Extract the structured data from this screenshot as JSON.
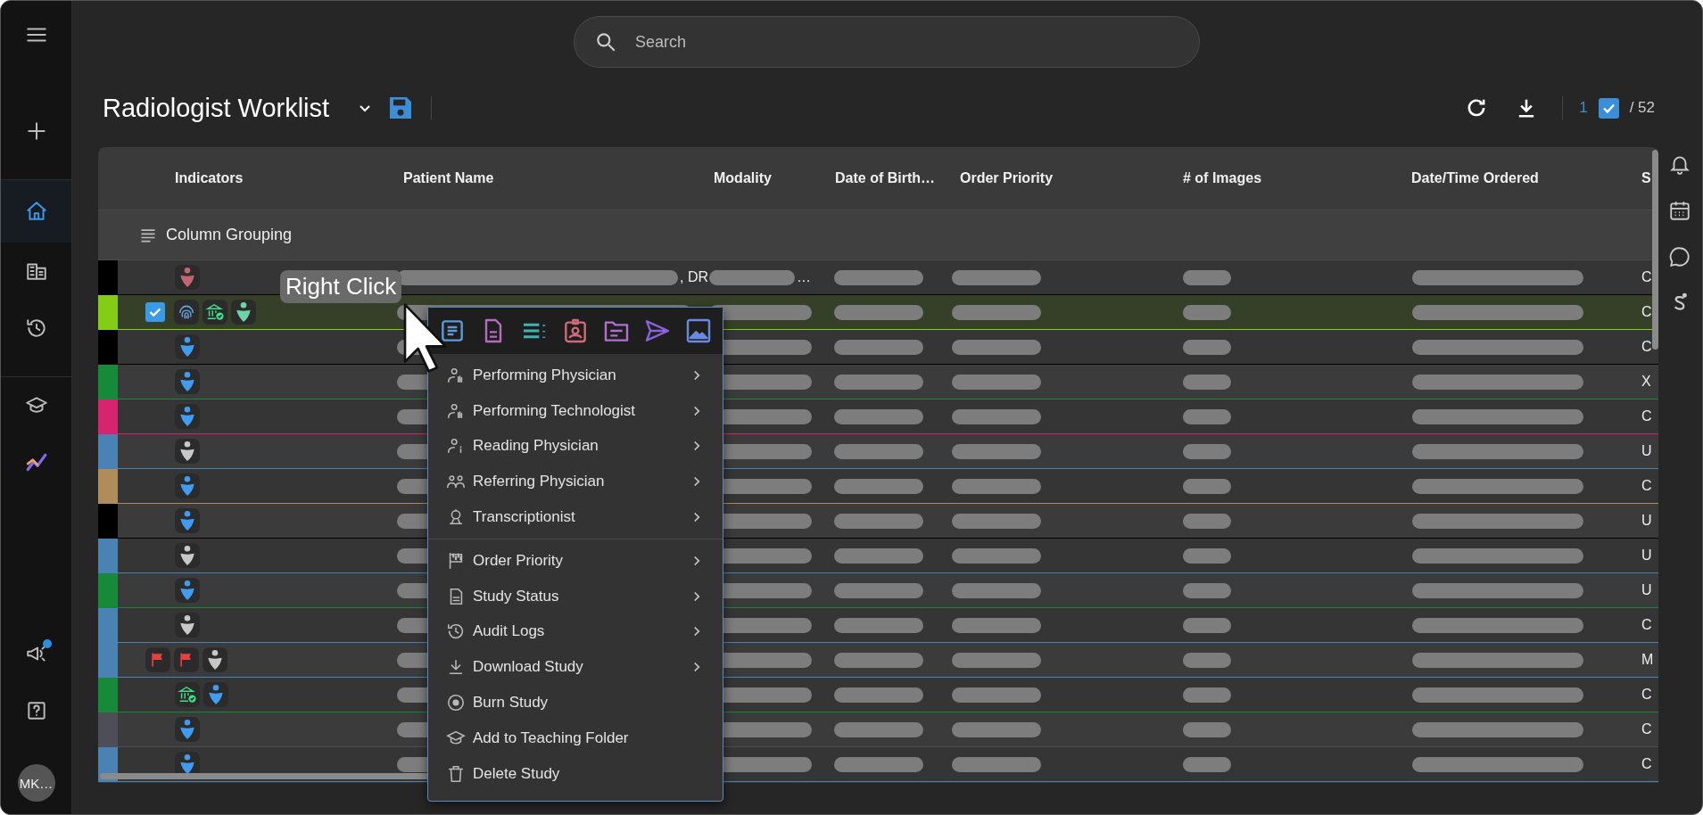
{
  "sidebar": {
    "items": [
      {
        "selected": false
      },
      {
        "selected": false
      },
      {
        "selected": true
      },
      {
        "selected": false
      },
      {
        "selected": false
      },
      {
        "selected": false
      },
      {
        "selected": false
      },
      {
        "selected": false,
        "notification": true
      },
      {
        "selected": false
      }
    ],
    "avatar": {
      "initials": "MK…"
    }
  },
  "search": {
    "placeholder": "Search"
  },
  "title": "Radiologist Worklist",
  "selection": {
    "count": "1",
    "checked": true,
    "total": "/ 52"
  },
  "table": {
    "columns": [
      "Indicators",
      "Patient Name",
      "Modality",
      "Date of Birth…",
      "Order Priority",
      "# of Images",
      "Date/Time Ordered",
      "S"
    ],
    "grouping": "Column Grouping",
    "rows": [
      {
        "color": "#000000",
        "selected": false,
        "indicators": [
          {
            "kind": "person",
            "color": "#c4646f"
          }
        ],
        "patient_name": ", DR",
        "modality": "…",
        "column_8": "C"
      },
      {
        "color": "#84cc16",
        "selected": true,
        "indicators": [
          {
            "kind": "fingerprint"
          },
          {
            "kind": "facility_check"
          },
          {
            "kind": "person",
            "color": "#6ed4a8"
          }
        ],
        "column_8": "C"
      },
      {
        "color": "#000000",
        "selected": false,
        "indicators": [
          {
            "kind": "person",
            "color": "#3f9cf0"
          }
        ],
        "column_8": "C"
      },
      {
        "color": "#178a3a",
        "selected": false,
        "indicators": [
          {
            "kind": "person",
            "color": "#3f9cf0"
          }
        ],
        "column_8": "X"
      },
      {
        "color": "#d6246e",
        "selected": false,
        "indicators": [
          {
            "kind": "person",
            "color": "#3f9cf0"
          }
        ],
        "column_8": "C"
      },
      {
        "color": "#4a82b4",
        "selected": false,
        "indicators": [
          {
            "kind": "person",
            "color": "#c8c8c8"
          }
        ],
        "column_8": "U"
      },
      {
        "color": "#b08c5a",
        "selected": false,
        "indicators": [
          {
            "kind": "person",
            "color": "#3f9cf0"
          }
        ],
        "column_8": "C"
      },
      {
        "color": "#000000",
        "selected": false,
        "indicators": [
          {
            "kind": "person",
            "color": "#3f9cf0"
          }
        ],
        "column_8": "U"
      },
      {
        "color": "#4a82b4",
        "selected": false,
        "indicators": [
          {
            "kind": "person",
            "color": "#c8c8c8"
          }
        ],
        "column_8": "U"
      },
      {
        "color": "#178a3a",
        "selected": false,
        "indicators": [
          {
            "kind": "person",
            "color": "#3f9cf0"
          }
        ],
        "column_8": "U"
      },
      {
        "color": "#4a82b4",
        "selected": false,
        "indicators": [
          {
            "kind": "person",
            "color": "#c8c8c8"
          }
        ],
        "column_8": "C"
      },
      {
        "color": "#4a82b4",
        "selected": false,
        "indicators": [
          {
            "kind": "flag"
          },
          {
            "kind": "flag"
          },
          {
            "kind": "person",
            "color": "#c8c8c8"
          }
        ],
        "column_8": "M"
      },
      {
        "color": "#178a3a",
        "selected": false,
        "indicators": [
          {
            "kind": "facility_check"
          },
          {
            "kind": "person",
            "color": "#3f9cf0"
          }
        ],
        "column_8": "C"
      },
      {
        "color": "#4e4e58",
        "selected": false,
        "indicators": [
          {
            "kind": "person",
            "color": "#3f9cf0"
          }
        ],
        "column_8": "C"
      },
      {
        "color": "#4a82b4",
        "selected": false,
        "indicators": [
          {
            "kind": "person",
            "color": "#3f9cf0"
          }
        ],
        "column_8": "C"
      }
    ]
  },
  "tooltip": "Right Click",
  "context_menu": {
    "sections": [
      {
        "items": [
          {
            "label": "Performing Physician",
            "submenu": true
          },
          {
            "label": "Performing Technologist",
            "submenu": true
          },
          {
            "label": "Reading Physician",
            "submenu": true
          },
          {
            "label": "Referring Physician",
            "submenu": true
          },
          {
            "label": "Transcriptionist",
            "submenu": true
          }
        ]
      },
      {
        "items": [
          {
            "label": "Order Priority",
            "submenu": true
          },
          {
            "label": "Study Status",
            "submenu": true
          },
          {
            "label": "Audit Logs",
            "submenu": true
          },
          {
            "label": "Download Study",
            "submenu": true
          },
          {
            "label": "Burn Study",
            "submenu": false
          },
          {
            "label": "Add to Teaching Folder",
            "submenu": false
          },
          {
            "label": "Delete Study",
            "submenu": false
          }
        ]
      }
    ]
  }
}
